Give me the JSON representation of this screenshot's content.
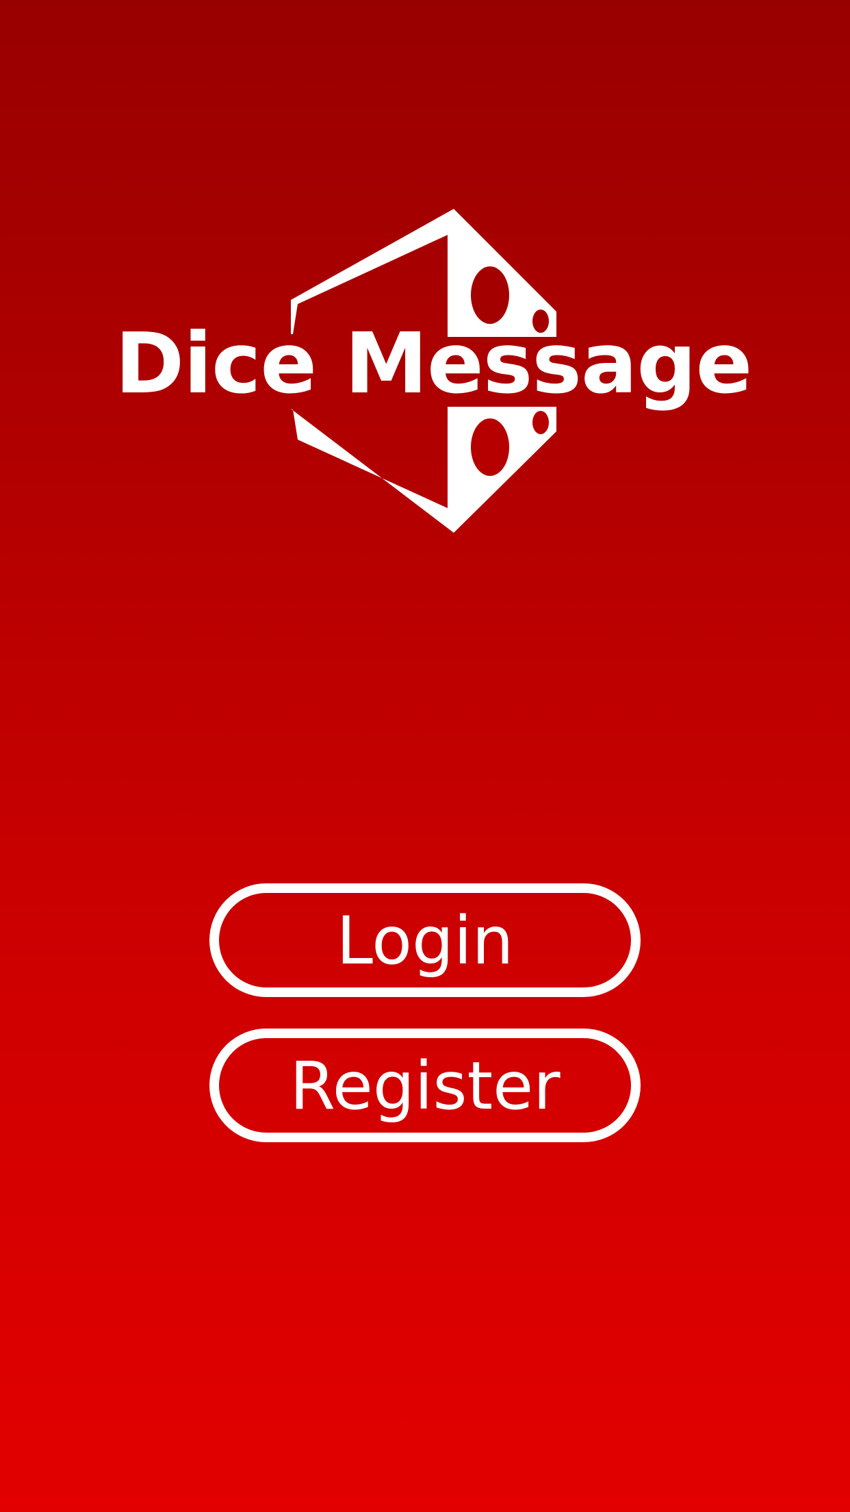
{
  "app": {
    "name": "Dice Message"
  },
  "buttons": {
    "login_label": "Login",
    "register_label": "Register"
  },
  "colors": {
    "background_top": "#990000",
    "background_bottom": "#e20000",
    "foreground": "#ffffff"
  },
  "icons": {
    "logo": "dice-icon"
  }
}
